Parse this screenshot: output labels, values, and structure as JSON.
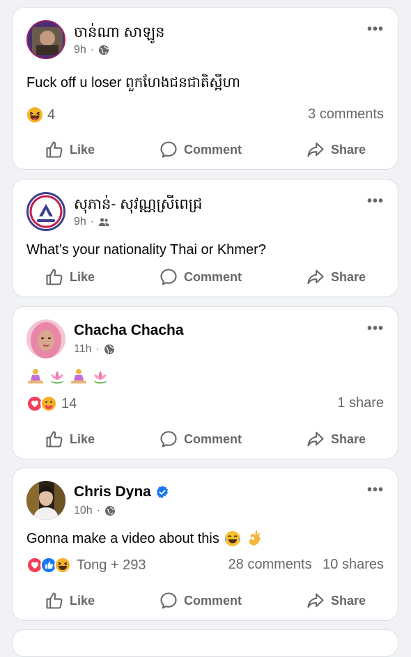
{
  "posts": [
    {
      "author": "ចាន់ណា សាឡូន",
      "time": "9h",
      "text": "Fuck off u loser ពួកហែងជនជាតិស្អីហា",
      "reaction_count": "4",
      "comments": "3 comments",
      "shares": ""
    },
    {
      "author": "សុភាន់- សុវណ្ណស្រីពេជ្រ",
      "time": "9h",
      "text": "What’s your nationality Thai or Khmer?"
    },
    {
      "author": "Chacha Chacha",
      "time": "11h",
      "reaction_count": "14",
      "shares": "1 share"
    },
    {
      "author": "Chris Dyna",
      "time": "10h",
      "text": "Gonna make a video about this",
      "reaction_summary": "Tong + 293",
      "comments": "28 comments",
      "shares": "10 shares"
    }
  ],
  "actions": {
    "like": "Like",
    "comment": "Comment",
    "share": "Share"
  },
  "icons": {
    "more": "more-options-icon",
    "globe": "globe-icon",
    "friends": "friends-icon",
    "verified": "verified-badge-icon"
  },
  "colors": {
    "facebook_blue": "#1877f2",
    "love_red": "#f33e58",
    "haha_yellow": "#f7b125",
    "muted_text": "#65676b"
  }
}
